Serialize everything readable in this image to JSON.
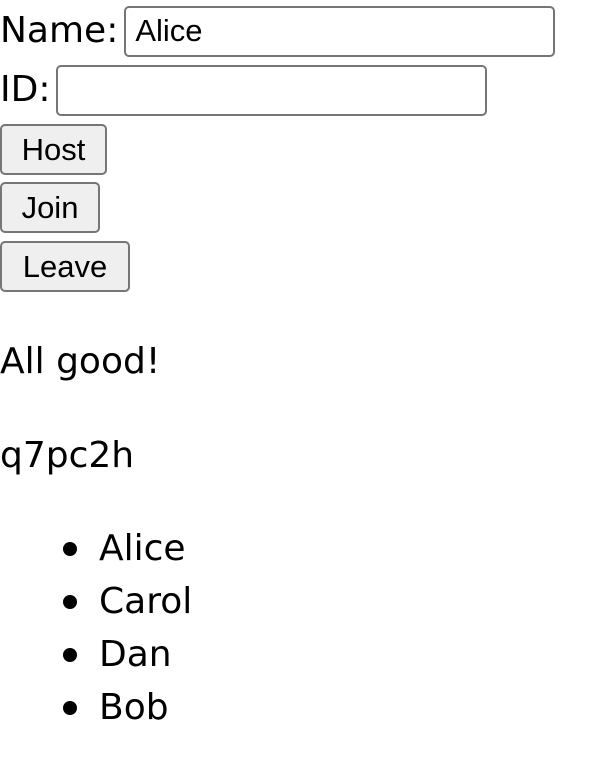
{
  "form": {
    "name_label": "Name:",
    "name_value": "Alice",
    "id_label": "ID:",
    "id_value": ""
  },
  "buttons": {
    "host_label": "Host",
    "join_label": "Join",
    "leave_label": "Leave"
  },
  "status": {
    "message": "All good!",
    "room_id": "q7pc2h"
  },
  "players": [
    "Alice",
    "Carol",
    "Dan",
    "Bob"
  ]
}
